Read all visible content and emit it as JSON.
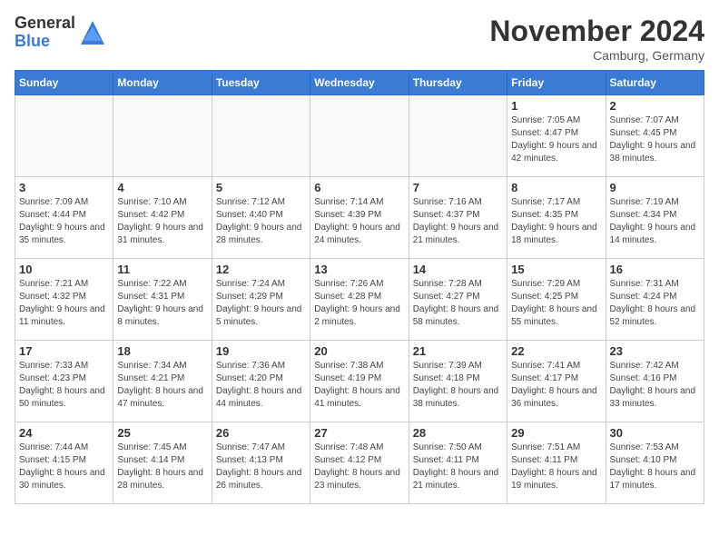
{
  "logo": {
    "general": "General",
    "blue": "Blue"
  },
  "title": "November 2024",
  "location": "Camburg, Germany",
  "days_of_week": [
    "Sunday",
    "Monday",
    "Tuesday",
    "Wednesday",
    "Thursday",
    "Friday",
    "Saturday"
  ],
  "weeks": [
    [
      {
        "day": "",
        "sunrise": "",
        "sunset": "",
        "daylight": ""
      },
      {
        "day": "",
        "sunrise": "",
        "sunset": "",
        "daylight": ""
      },
      {
        "day": "",
        "sunrise": "",
        "sunset": "",
        "daylight": ""
      },
      {
        "day": "",
        "sunrise": "",
        "sunset": "",
        "daylight": ""
      },
      {
        "day": "",
        "sunrise": "",
        "sunset": "",
        "daylight": ""
      },
      {
        "day": "1",
        "sunrise": "Sunrise: 7:05 AM",
        "sunset": "Sunset: 4:47 PM",
        "daylight": "Daylight: 9 hours and 42 minutes."
      },
      {
        "day": "2",
        "sunrise": "Sunrise: 7:07 AM",
        "sunset": "Sunset: 4:45 PM",
        "daylight": "Daylight: 9 hours and 38 minutes."
      }
    ],
    [
      {
        "day": "3",
        "sunrise": "Sunrise: 7:09 AM",
        "sunset": "Sunset: 4:44 PM",
        "daylight": "Daylight: 9 hours and 35 minutes."
      },
      {
        "day": "4",
        "sunrise": "Sunrise: 7:10 AM",
        "sunset": "Sunset: 4:42 PM",
        "daylight": "Daylight: 9 hours and 31 minutes."
      },
      {
        "day": "5",
        "sunrise": "Sunrise: 7:12 AM",
        "sunset": "Sunset: 4:40 PM",
        "daylight": "Daylight: 9 hours and 28 minutes."
      },
      {
        "day": "6",
        "sunrise": "Sunrise: 7:14 AM",
        "sunset": "Sunset: 4:39 PM",
        "daylight": "Daylight: 9 hours and 24 minutes."
      },
      {
        "day": "7",
        "sunrise": "Sunrise: 7:16 AM",
        "sunset": "Sunset: 4:37 PM",
        "daylight": "Daylight: 9 hours and 21 minutes."
      },
      {
        "day": "8",
        "sunrise": "Sunrise: 7:17 AM",
        "sunset": "Sunset: 4:35 PM",
        "daylight": "Daylight: 9 hours and 18 minutes."
      },
      {
        "day": "9",
        "sunrise": "Sunrise: 7:19 AM",
        "sunset": "Sunset: 4:34 PM",
        "daylight": "Daylight: 9 hours and 14 minutes."
      }
    ],
    [
      {
        "day": "10",
        "sunrise": "Sunrise: 7:21 AM",
        "sunset": "Sunset: 4:32 PM",
        "daylight": "Daylight: 9 hours and 11 minutes."
      },
      {
        "day": "11",
        "sunrise": "Sunrise: 7:22 AM",
        "sunset": "Sunset: 4:31 PM",
        "daylight": "Daylight: 9 hours and 8 minutes."
      },
      {
        "day": "12",
        "sunrise": "Sunrise: 7:24 AM",
        "sunset": "Sunset: 4:29 PM",
        "daylight": "Daylight: 9 hours and 5 minutes."
      },
      {
        "day": "13",
        "sunrise": "Sunrise: 7:26 AM",
        "sunset": "Sunset: 4:28 PM",
        "daylight": "Daylight: 9 hours and 2 minutes."
      },
      {
        "day": "14",
        "sunrise": "Sunrise: 7:28 AM",
        "sunset": "Sunset: 4:27 PM",
        "daylight": "Daylight: 8 hours and 58 minutes."
      },
      {
        "day": "15",
        "sunrise": "Sunrise: 7:29 AM",
        "sunset": "Sunset: 4:25 PM",
        "daylight": "Daylight: 8 hours and 55 minutes."
      },
      {
        "day": "16",
        "sunrise": "Sunrise: 7:31 AM",
        "sunset": "Sunset: 4:24 PM",
        "daylight": "Daylight: 8 hours and 52 minutes."
      }
    ],
    [
      {
        "day": "17",
        "sunrise": "Sunrise: 7:33 AM",
        "sunset": "Sunset: 4:23 PM",
        "daylight": "Daylight: 8 hours and 50 minutes."
      },
      {
        "day": "18",
        "sunrise": "Sunrise: 7:34 AM",
        "sunset": "Sunset: 4:21 PM",
        "daylight": "Daylight: 8 hours and 47 minutes."
      },
      {
        "day": "19",
        "sunrise": "Sunrise: 7:36 AM",
        "sunset": "Sunset: 4:20 PM",
        "daylight": "Daylight: 8 hours and 44 minutes."
      },
      {
        "day": "20",
        "sunrise": "Sunrise: 7:38 AM",
        "sunset": "Sunset: 4:19 PM",
        "daylight": "Daylight: 8 hours and 41 minutes."
      },
      {
        "day": "21",
        "sunrise": "Sunrise: 7:39 AM",
        "sunset": "Sunset: 4:18 PM",
        "daylight": "Daylight: 8 hours and 38 minutes."
      },
      {
        "day": "22",
        "sunrise": "Sunrise: 7:41 AM",
        "sunset": "Sunset: 4:17 PM",
        "daylight": "Daylight: 8 hours and 36 minutes."
      },
      {
        "day": "23",
        "sunrise": "Sunrise: 7:42 AM",
        "sunset": "Sunset: 4:16 PM",
        "daylight": "Daylight: 8 hours and 33 minutes."
      }
    ],
    [
      {
        "day": "24",
        "sunrise": "Sunrise: 7:44 AM",
        "sunset": "Sunset: 4:15 PM",
        "daylight": "Daylight: 8 hours and 30 minutes."
      },
      {
        "day": "25",
        "sunrise": "Sunrise: 7:45 AM",
        "sunset": "Sunset: 4:14 PM",
        "daylight": "Daylight: 8 hours and 28 minutes."
      },
      {
        "day": "26",
        "sunrise": "Sunrise: 7:47 AM",
        "sunset": "Sunset: 4:13 PM",
        "daylight": "Daylight: 8 hours and 26 minutes."
      },
      {
        "day": "27",
        "sunrise": "Sunrise: 7:48 AM",
        "sunset": "Sunset: 4:12 PM",
        "daylight": "Daylight: 8 hours and 23 minutes."
      },
      {
        "day": "28",
        "sunrise": "Sunrise: 7:50 AM",
        "sunset": "Sunset: 4:11 PM",
        "daylight": "Daylight: 8 hours and 21 minutes."
      },
      {
        "day": "29",
        "sunrise": "Sunrise: 7:51 AM",
        "sunset": "Sunset: 4:11 PM",
        "daylight": "Daylight: 8 hours and 19 minutes."
      },
      {
        "day": "30",
        "sunrise": "Sunrise: 7:53 AM",
        "sunset": "Sunset: 4:10 PM",
        "daylight": "Daylight: 8 hours and 17 minutes."
      }
    ]
  ]
}
